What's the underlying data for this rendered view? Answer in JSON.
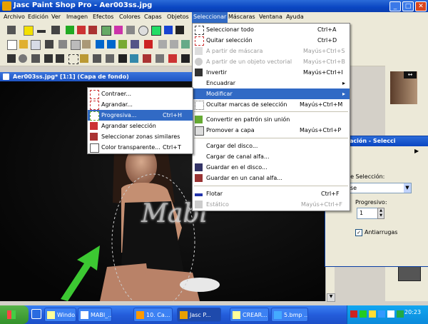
{
  "window": {
    "title": "Jasc Paint Shop Pro - Aer003ss.jpg",
    "min": "_",
    "max": "□",
    "close": "✕"
  },
  "menubar": [
    "Archivo",
    "Edición",
    "Ver",
    "Imagen",
    "Efectos",
    "Colores",
    "Capas",
    "Objetos",
    "Seleccionar",
    "Máscaras",
    "Ventana",
    "Ayuda"
  ],
  "image_window": {
    "title": "Aer003ss.jpg* [1:1] (Capa de fondo)"
  },
  "watermark": "Mabi",
  "select_menu": {
    "items": [
      {
        "label": "Seleccionar todo",
        "shortcut": "Ctrl+A"
      },
      {
        "label": "Quitar selección",
        "shortcut": "Ctrl+D"
      },
      {
        "label": "A partir de máscara",
        "shortcut": "Mayús+Ctrl+S"
      },
      {
        "label": "A partir de un objeto vectorial",
        "shortcut": "Mayús+Ctrl+B"
      },
      {
        "label": "Invertir",
        "shortcut": "Mayús+Ctrl+I"
      },
      {
        "label": "Encuadrar",
        "shortcut": ""
      },
      {
        "label": "Modificar",
        "shortcut": ""
      },
      {
        "label": "Ocultar marcas de selección",
        "shortcut": "Mayús+Ctrl+M"
      },
      {
        "label": "Convertir en patrón sin unión",
        "shortcut": ""
      },
      {
        "label": "Promover a capa",
        "shortcut": "Mayús+Ctrl+P"
      },
      {
        "label": "Cargar del disco...",
        "shortcut": ""
      },
      {
        "label": "Cargar de canal alfa...",
        "shortcut": ""
      },
      {
        "label": "Guardar en el disco...",
        "shortcut": ""
      },
      {
        "label": "Guardar en un canal alfa...",
        "shortcut": ""
      },
      {
        "label": "Flotar",
        "shortcut": "Ctrl+F"
      },
      {
        "label": "Estático",
        "shortcut": "Mayús+Ctrl+F"
      }
    ]
  },
  "modify_menu": {
    "items": [
      {
        "label": "Contraer...",
        "shortcut": ""
      },
      {
        "label": "Agrandar...",
        "shortcut": ""
      },
      {
        "label": "Progresiva...",
        "shortcut": "Ctrl+H"
      },
      {
        "label": "Agrandar selección",
        "shortcut": ""
      },
      {
        "label": "Seleccionar zonas similares",
        "shortcut": ""
      },
      {
        "label": "Color transparente...",
        "shortcut": "Ctrl+T"
      }
    ]
  },
  "dialog": {
    "title": "ración - Selecci",
    "type_label": "de Selección:",
    "type_value": "se",
    "feather_label": "Progresivo:",
    "feather_value": "1",
    "antialias_label": "Antiarrugas"
  },
  "taskbar": {
    "tasks": [
      "Windo...",
      "MABI_...",
      "10. Ca...",
      "Jasc P...",
      "CREAR...",
      "5.bmp ..."
    ],
    "clock": "20:23"
  },
  "colors": {
    "accent": "#316ac5",
    "titlebar": "#0a46c2",
    "arrow": "#3cc832"
  }
}
